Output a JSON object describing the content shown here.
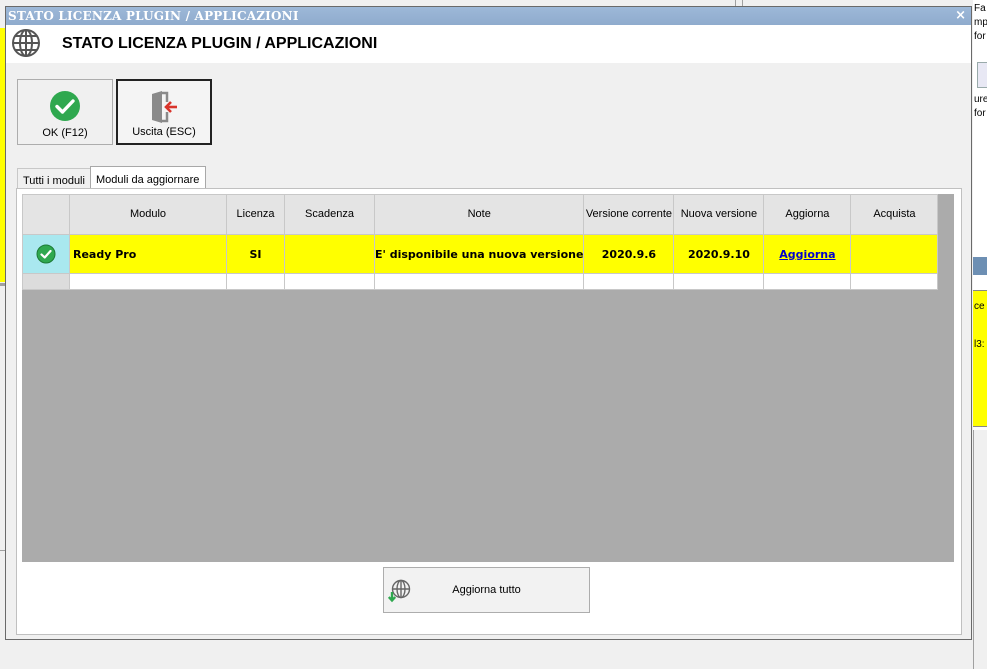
{
  "window": {
    "title": "STATO LICENZA PLUGIN / APPLICAZIONI",
    "close_glyph": "×"
  },
  "header": {
    "title": "STATO LICENZA PLUGIN / APPLICAZIONI",
    "icon": "globe-icon"
  },
  "toolbar": {
    "ok_label": "OK (F12)",
    "ok_icon": "check-circle-icon",
    "exit_label": "Uscita (ESC)",
    "exit_icon": "exit-door-icon"
  },
  "tabs": [
    {
      "label": "Tutti i moduli",
      "selected": false
    },
    {
      "label": "Moduli da aggiornare",
      "selected": true
    }
  ],
  "grid": {
    "columns": [
      "Modulo",
      "Licenza",
      "Scadenza",
      "Note",
      "Versione corrente",
      "Nuova versione",
      "Aggiorna",
      "Acquista"
    ],
    "rows": [
      {
        "status_icon": "check-circle-icon",
        "modulo": "Ready Pro",
        "licenza": "SI",
        "scadenza": "",
        "note": "E' disponibile una nuova versione",
        "versione_corrente": "2020.9.6",
        "nuova_versione": "2020.9.10",
        "aggiorna": "Aggiorna",
        "acquista": ""
      }
    ]
  },
  "footer": {
    "update_all_label": "Aggiorna tutto",
    "update_all_icon": "globe-download-icon"
  },
  "background_right": {
    "t1": "Fa",
    "t2": "mp",
    "t3": "for",
    "t4": "ure",
    "t5": "for",
    "t6": "ce",
    "t7": "l3:"
  },
  "colors": {
    "title_bar": "#8fabcd",
    "row_highlight": "#ffff00",
    "selector_cell": "#a9e8ef",
    "grid_background": "#ababab",
    "ok_green": "#2fa84f",
    "exit_red": "#d9342b",
    "link": "#0000cc"
  }
}
